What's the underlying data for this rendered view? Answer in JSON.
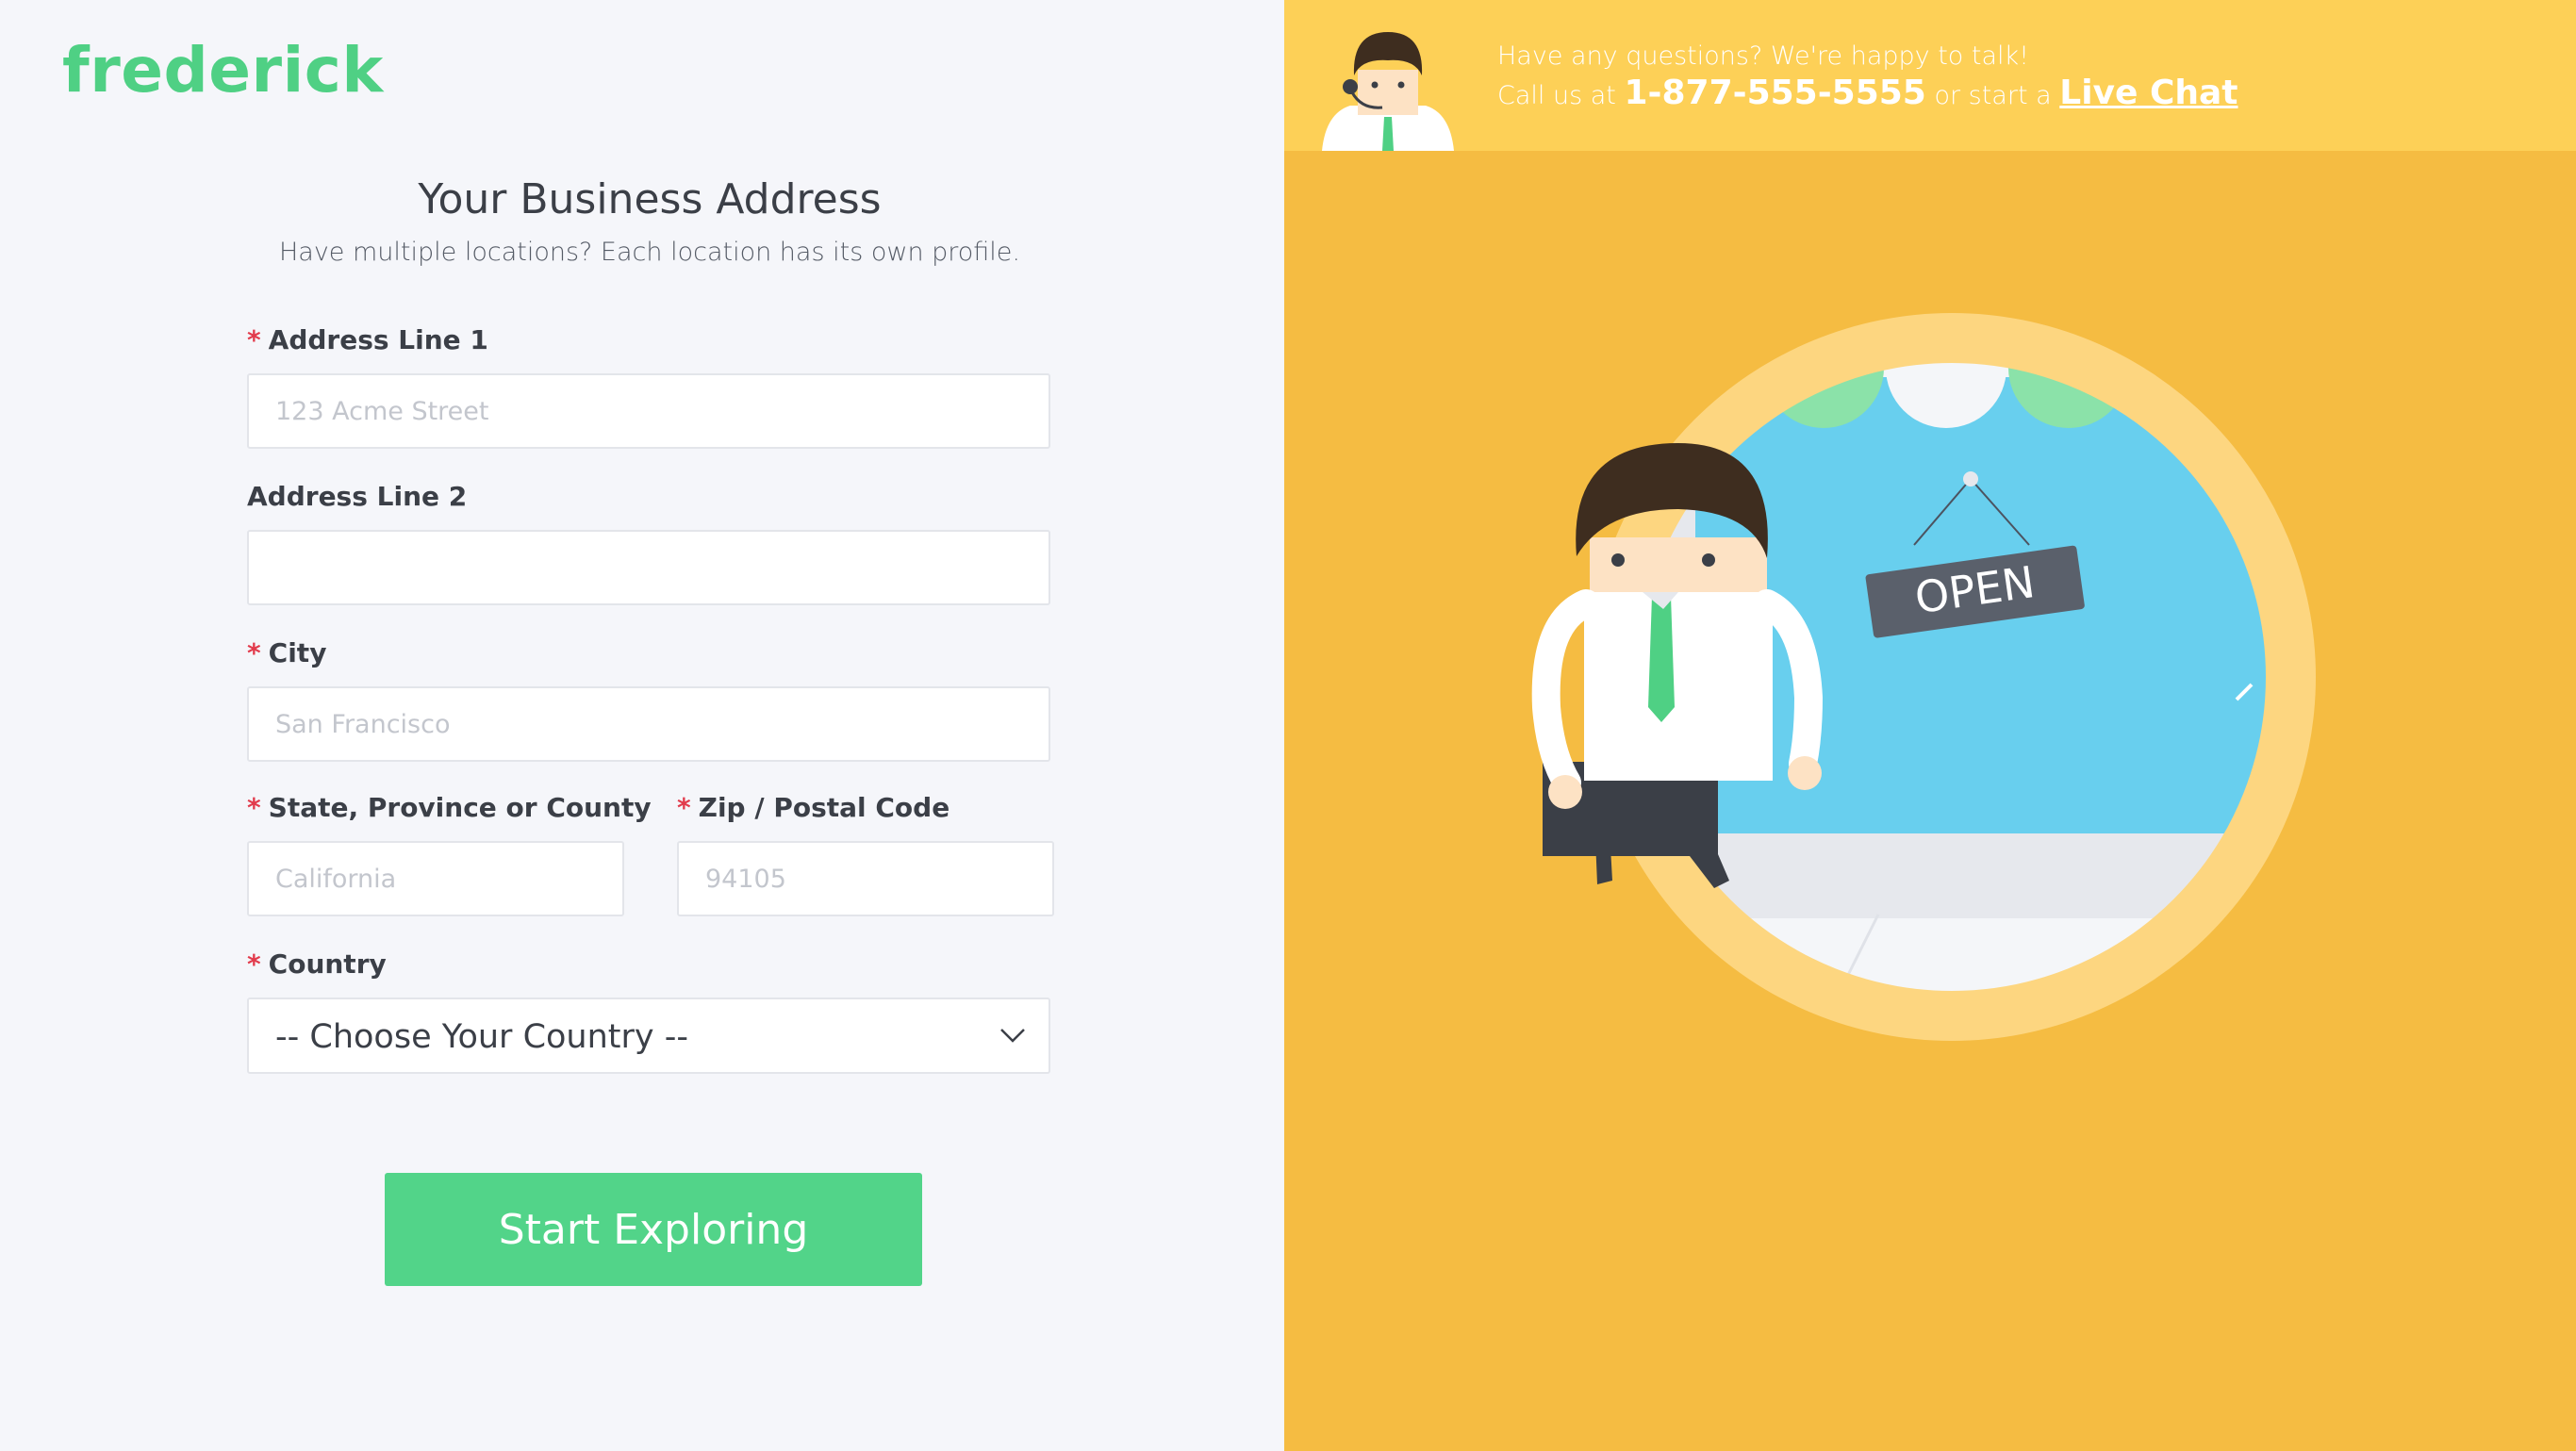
{
  "brand": {
    "logo": "frederick",
    "color": "#4fd084"
  },
  "form": {
    "title": "Your Business Address",
    "subtitle": "Have multiple locations? Each location has its own profile.",
    "required_marker": "*",
    "address1": {
      "label": "Address Line 1",
      "placeholder": "123 Acme Street",
      "required": true
    },
    "address2": {
      "label": "Address Line 2",
      "placeholder": "",
      "required": false
    },
    "city": {
      "label": "City",
      "placeholder": "San Francisco",
      "required": true
    },
    "state": {
      "label": "State, Province or County",
      "placeholder": "California",
      "required": true
    },
    "zip": {
      "label": "Zip / Postal Code",
      "placeholder": "94105",
      "required": true
    },
    "country": {
      "label": "Country",
      "selected": "-- Choose Your Country --",
      "required": true
    },
    "submit_label": "Start Exploring"
  },
  "support": {
    "question": "Have any questions? We're happy to talk!",
    "call_prefix": "Call us at",
    "phone": "1-877-555-5555",
    "mid": "or start a",
    "chat_label": "Live Chat"
  },
  "illustration": {
    "sign_text": "OPEN"
  },
  "colors": {
    "accent": "#52d489",
    "panel": "#f5bc42",
    "topbar": "#fdd057",
    "required": "#e23b4c"
  }
}
